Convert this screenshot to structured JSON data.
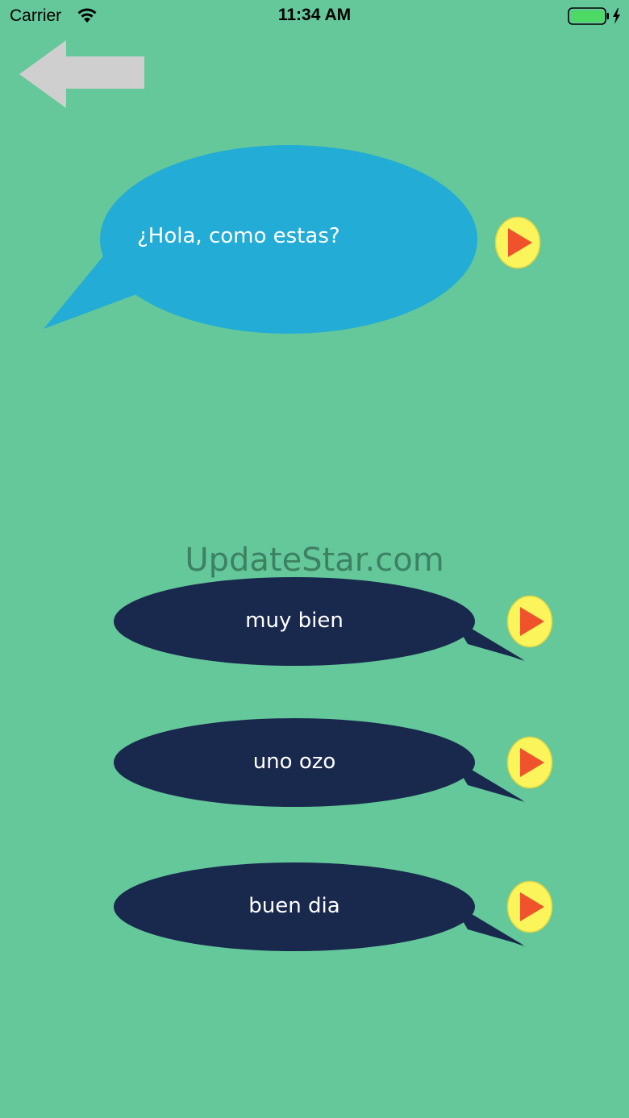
{
  "status_bar": {
    "carrier": "Carrier",
    "time": "11:34 AM",
    "wifi_icon": "wifi-icon",
    "battery_icon": "battery-charging-icon",
    "battery_color": "#4cd964"
  },
  "navigation": {
    "back_icon": "left-arrow-icon"
  },
  "question": {
    "text": "¿Hola, como estas?",
    "bubble_color": "#22acd6",
    "play_icon": "play-icon"
  },
  "answers": [
    {
      "text": "muy bien",
      "play_icon": "play-icon"
    },
    {
      "text": "uno ozo",
      "play_icon": "play-icon"
    },
    {
      "text": "buen dia",
      "play_icon": "play-icon"
    }
  ],
  "answer_bubble_color": "#19284d",
  "play_button_colors": {
    "fill": "#fbf45a",
    "triangle": "#f0522c"
  },
  "background_color": "#64c89a",
  "watermark": "UpdateStar.com"
}
